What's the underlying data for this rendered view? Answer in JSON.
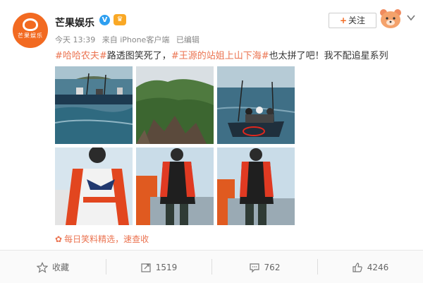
{
  "account": {
    "name": "芒果娱乐",
    "logo_text": "芒果娱乐",
    "verified_icon": "verified-badge-icon",
    "member_icon": "member-crown-icon"
  },
  "meta": {
    "time": "今天 13:39",
    "source": "来自 iPhone客户端",
    "edited": "已编辑"
  },
  "follow": {
    "plus": "+",
    "label": "关注"
  },
  "post": {
    "tag1": "#哈哈农夫#",
    "text1": "路透图笑死了，",
    "tag2": "#王源的站姐上山下海#",
    "text2": "也太拼了吧！我不配追星系列"
  },
  "images": [
    {
      "name": "boat-at-sea-photo"
    },
    {
      "name": "rocky-island-photo"
    },
    {
      "name": "boat-with-crew-photo"
    },
    {
      "name": "man-red-jacket-closeup-photo"
    },
    {
      "name": "man-red-jacket-pier-photo"
    },
    {
      "name": "man-red-jacket-pier-photo-2"
    }
  ],
  "source_line": {
    "icon": "flower-icon",
    "text": "每日笑料精选，速查收"
  },
  "actions": {
    "favorite": "收藏",
    "repost": "1519",
    "comment": "762",
    "like": "4246"
  },
  "colors": {
    "brand": "#f26a21",
    "hashtag": "#eb7350",
    "verified": "#2e9ff0"
  }
}
